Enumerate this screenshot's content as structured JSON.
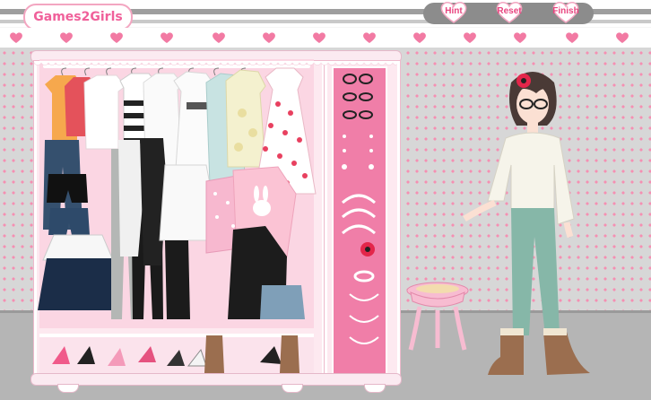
{
  "header": {
    "logo_text": "Games2Girls",
    "buttons": {
      "hint": "Hint",
      "reset": "Reset",
      "finish": "Finish"
    }
  },
  "colors": {
    "accent_pink": "#f0609a",
    "wall": "#d7d7d7",
    "wall_dots": "#f58fb2",
    "floor": "#b5b5b5",
    "panel_pink": "#f07ea8",
    "button_bar": "#8c8c8c"
  },
  "wardrobe": {
    "hanging_items": [
      "orange-top",
      "red-top",
      "white-top",
      "striped-top",
      "white-tunic",
      "belted-dress",
      "mint-dress",
      "floral-dress",
      "polka-dot-dress"
    ],
    "bottoms": [
      "denim-jeans",
      "black-shorts",
      "denim-shorts",
      "white-navy-skirt",
      "grey-leggings",
      "black-leggings",
      "white-skirt",
      "pink-dot-top",
      "pink-bunny-sweater",
      "black-jacket",
      "denim-vest",
      "fur-boots"
    ],
    "shoes": [
      "pink-heels",
      "black-heels",
      "pink-heels-2",
      "black-sandals",
      "white-sandals",
      "brown-boots",
      "black-strappy-heels"
    ],
    "accessories": [
      "glasses-black-1",
      "glasses-black-2",
      "glasses-black-3",
      "earrings-1",
      "earrings-2",
      "earrings-3",
      "headband-1",
      "headband-2",
      "headband-3",
      "hair-flower",
      "bracelet",
      "necklace-1",
      "necklace-2",
      "necklace-3"
    ]
  },
  "model": {
    "outfit": [
      "white-peasant-blouse",
      "mint-skinny-jeans",
      "brown-boots",
      "black-glasses",
      "red-hair-flower"
    ]
  }
}
